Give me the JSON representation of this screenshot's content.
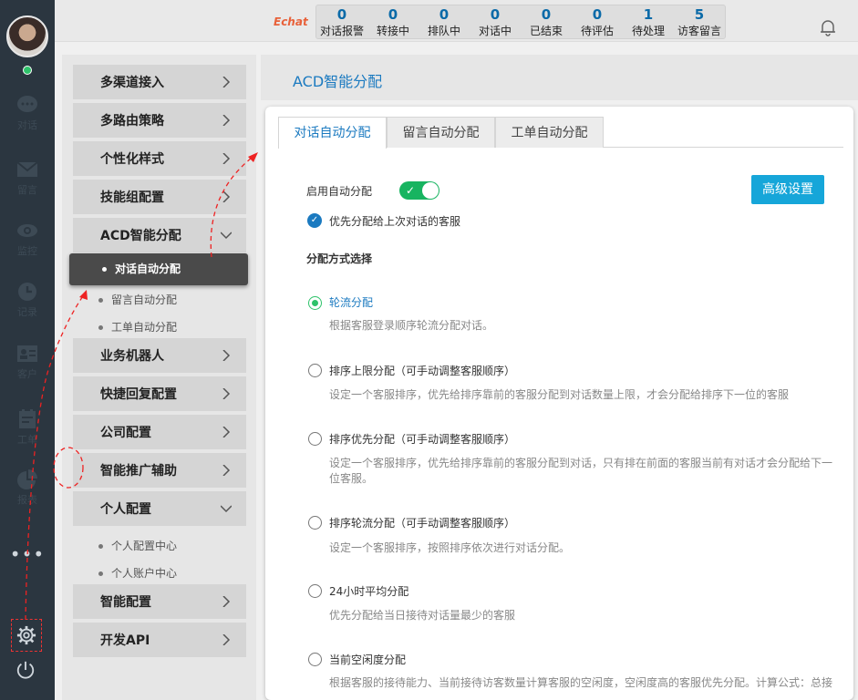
{
  "rail": {
    "items": [
      {
        "label": "对话",
        "icon": "chat-icon"
      },
      {
        "label": "留言",
        "icon": "mail-icon"
      },
      {
        "label": "监控",
        "icon": "eye-icon"
      },
      {
        "label": "记录",
        "icon": "clock-icon"
      },
      {
        "label": "客户",
        "icon": "contact-card-icon"
      },
      {
        "label": "工单",
        "icon": "ticket-icon"
      },
      {
        "label": "报表",
        "icon": "pie-chart-icon"
      }
    ],
    "more": "•••"
  },
  "topbar": {
    "logo": "Echat",
    "stats": [
      {
        "num": "0",
        "label": "对话报警"
      },
      {
        "num": "0",
        "label": "转接中"
      },
      {
        "num": "0",
        "label": "排队中"
      },
      {
        "num": "0",
        "label": "对话中"
      },
      {
        "num": "0",
        "label": "已结束"
      },
      {
        "num": "0",
        "label": "待评估"
      },
      {
        "num": "1",
        "label": "待处理"
      },
      {
        "num": "5",
        "label": "访客留言"
      }
    ]
  },
  "nav": {
    "items": [
      "多渠道接入",
      "多路由策略",
      "个性化样式",
      "技能组配置",
      "ACD智能分配",
      "业务机器人",
      "快捷回复配置",
      "公司配置",
      "智能推广辅助",
      "个人配置",
      "智能配置",
      "开发API"
    ],
    "acd_subs": [
      "对话自动分配",
      "留言自动分配",
      "工单自动分配"
    ],
    "personal_subs": [
      "个人配置中心",
      "个人账户中心"
    ]
  },
  "main": {
    "title": "ACD智能分配",
    "tabs": [
      "对话自动分配",
      "留言自动分配",
      "工单自动分配"
    ],
    "enable_label": "启用自动分配",
    "enable_on": true,
    "advanced_button": "高级设置",
    "prefer_last_label": "优先分配给上次对话的客服",
    "section_title": "分配方式选择",
    "options": [
      {
        "title": "轮流分配",
        "desc": "根据客服登录顺序轮流分配对话。",
        "selected": true
      },
      {
        "title": "排序上限分配（可手动调整客服顺序）",
        "desc": "设定一个客服排序，优先给排序靠前的客服分配到对话数量上限，才会分配给排序下一位的客服",
        "selected": false
      },
      {
        "title": "排序优先分配（可手动调整客服顺序）",
        "desc": "设定一个客服排序，优先给排序靠前的客服分配到对话，只有排在前面的客服当前有对话才会分配给下一位客服。",
        "selected": false
      },
      {
        "title": "排序轮流分配（可手动调整客服顺序）",
        "desc": "设定一个客服排序，按照排序依次进行对话分配。",
        "selected": false
      },
      {
        "title": "24小时平均分配",
        "desc": "优先分配给当日接待对话量最少的客服",
        "selected": false
      },
      {
        "title": "当前空闲度分配",
        "desc": "根据客服的接待能力、当前接待访客数量计算客服的空闲度，空闲度高的客服优先分配。计算公式：总接",
        "selected": false
      }
    ]
  },
  "colors": {
    "accent": "#1b7ac0",
    "toggle": "#17b460",
    "button": "#16a6d9",
    "rail": "#2b3640"
  }
}
